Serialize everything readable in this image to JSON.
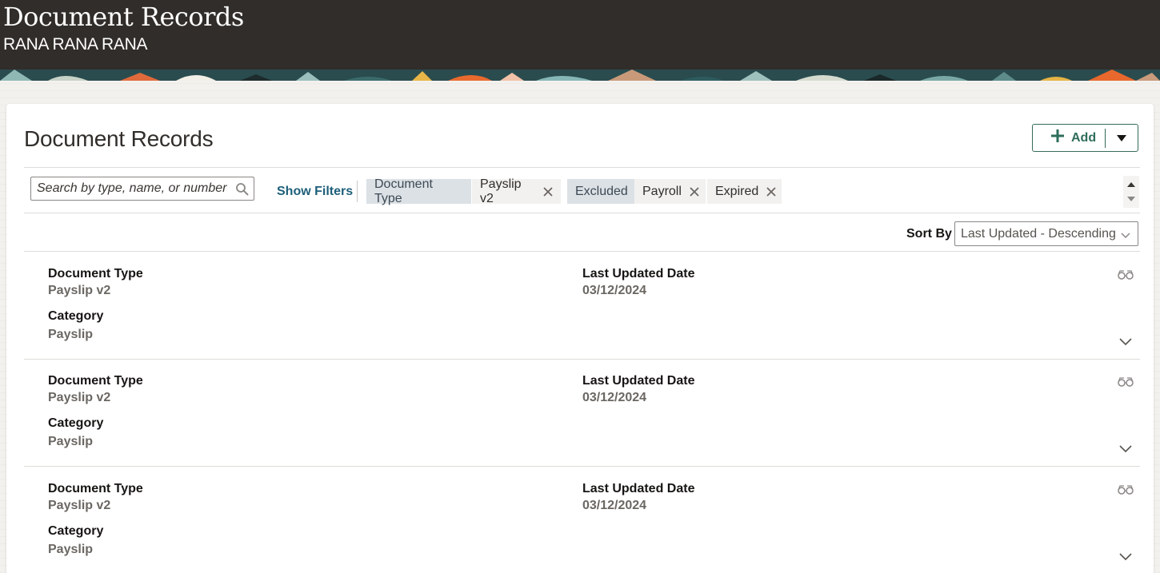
{
  "header": {
    "title": "Document Records",
    "subtitle": "RANA RANA RANA"
  },
  "main": {
    "title": "Document Records",
    "add_label": "Add",
    "search": {
      "placeholder": "Search by type, name, or number"
    },
    "show_filters_label": "Show Filters",
    "filter_chips": [
      {
        "label": "Document Type",
        "values": [
          "Payslip v2"
        ]
      },
      {
        "label": "Excluded",
        "values": [
          "Payroll",
          "Expired"
        ]
      }
    ],
    "sort": {
      "label": "Sort By",
      "value": "Last Updated - Descending"
    },
    "records": [
      {
        "document_type_label": "Document Type",
        "document_type": "Payslip v2",
        "category_label": "Category",
        "category": "Payslip",
        "last_updated_label": "Last Updated Date",
        "last_updated": "03/12/2024"
      },
      {
        "document_type_label": "Document Type",
        "document_type": "Payslip v2",
        "category_label": "Category",
        "category": "Payslip",
        "last_updated_label": "Last Updated Date",
        "last_updated": "03/12/2024"
      },
      {
        "document_type_label": "Document Type",
        "document_type": "Payslip v2",
        "category_label": "Category",
        "category": "Payslip",
        "last_updated_label": "Last Updated Date",
        "last_updated": "03/12/2024"
      }
    ]
  },
  "icons": {
    "search": "search-icon",
    "add": "plus-icon",
    "dropdown": "caret-down-icon",
    "remove": "close-icon",
    "view": "glasses-icon",
    "expand": "chevron-down-icon"
  },
  "colors": {
    "header_bg": "#312d2a",
    "accent_green": "#2f6d5b",
    "link_blue": "#1d5f7a",
    "chip_label_bg": "#dce1e6"
  }
}
